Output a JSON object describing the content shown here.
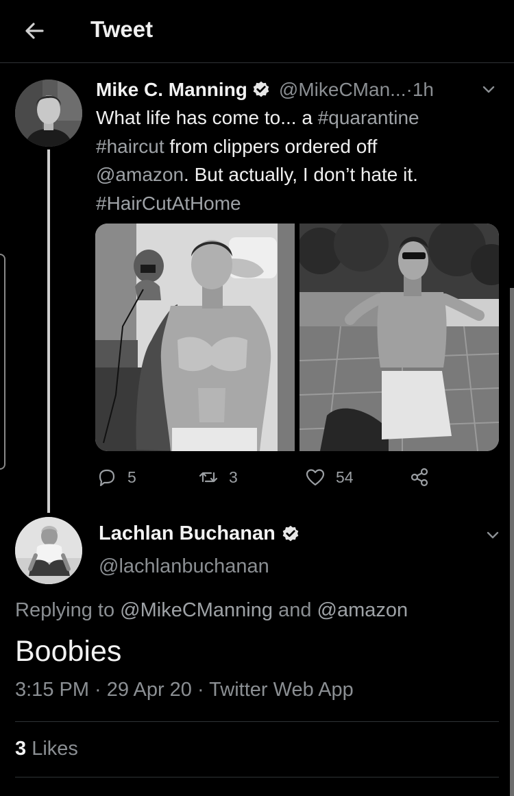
{
  "header": {
    "title": "Tweet"
  },
  "tweet": {
    "display_name": "Mike C. Manning",
    "handle": "@MikeCMan...",
    "separator": " · ",
    "time_ago": "1h",
    "text_parts": [
      "What life has come to... a ",
      "#quarantine",
      "#haircut",
      " from clippers ordered off",
      "@amazon",
      ". But actually, I don’t hate it.",
      "#HairCutAtHome"
    ],
    "actions": {
      "replies": "5",
      "retweets": "3",
      "likes": "54"
    }
  },
  "reply": {
    "display_name": "Lachlan Buchanan",
    "handle": "@lachlanbuchanan",
    "replying_prefix": "Replying to ",
    "replying_user1": "@MikeCManning",
    "replying_and": " and ",
    "replying_user2": "@amazon",
    "body": "Boobies",
    "meta": "3:15 PM · 29 Apr 20 · Twitter Web App",
    "likes_count": "3",
    "likes_label": " Likes"
  },
  "colors": {
    "background": "#000000",
    "text": "#f0f0f0",
    "muted": "#8b8f93",
    "divider": "#2f3336"
  }
}
